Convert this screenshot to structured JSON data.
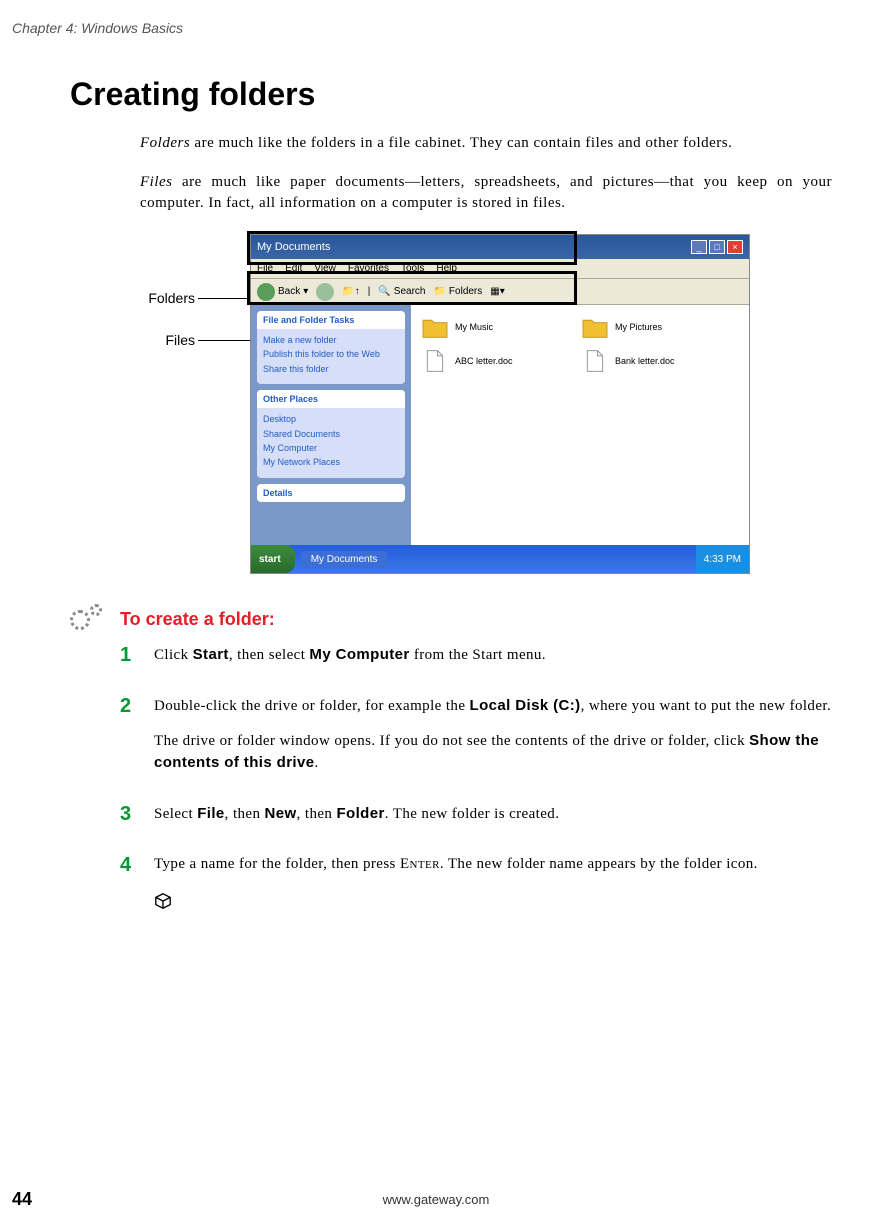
{
  "header": {
    "chapter_label": "Chapter 4: Windows Basics"
  },
  "title": "Creating folders",
  "intro": {
    "p1_emph": "Folders",
    "p1_rest": " are much like the folders in a file cabinet. They can contain files and other folders.",
    "p2_emph": "Files",
    "p2_rest": " are much like paper documents—letters, spreadsheets, and pictures—that you keep on your computer. In fact, all information on a computer is stored in files."
  },
  "callouts": {
    "folders": "Folders",
    "files": "Files"
  },
  "screenshot": {
    "title": "My Documents",
    "menu": [
      "File",
      "Edit",
      "View",
      "Favorites",
      "Tools",
      "Help"
    ],
    "toolbar": {
      "back": "Back",
      "search": "Search",
      "folders": "Folders"
    },
    "sidebar": {
      "panel1_title": "File and Folder Tasks",
      "panel1_items": [
        "Make a new folder",
        "Publish this folder to the Web",
        "Share this folder"
      ],
      "panel2_title": "Other Places",
      "panel2_items": [
        "Desktop",
        "Shared Documents",
        "My Computer",
        "My Network Places"
      ],
      "panel3_title": "Details"
    },
    "items": {
      "folder1": "My Music",
      "folder2": "My Pictures",
      "file1": "ABC letter.doc",
      "file2": "Bank letter.doc"
    },
    "taskbar": {
      "start": "start",
      "item": "My Documents",
      "clock": "4:33 PM"
    }
  },
  "procedure": {
    "title": "To create a folder:",
    "steps": [
      {
        "num": "1",
        "parts": [
          {
            "t": "Click ",
            "cls": ""
          },
          {
            "t": "Start",
            "cls": "bold-sans"
          },
          {
            "t": ", then select ",
            "cls": ""
          },
          {
            "t": "My Computer",
            "cls": "bold-sans"
          },
          {
            "t": " from the Start menu.",
            "cls": ""
          }
        ]
      },
      {
        "num": "2",
        "paragraphs": [
          [
            {
              "t": "Double-click the drive or folder, for example the ",
              "cls": ""
            },
            {
              "t": "Local Disk (C:)",
              "cls": "bold-sans"
            },
            {
              "t": ", where you want to put the new folder.",
              "cls": ""
            }
          ],
          [
            {
              "t": "The drive or folder window opens. If you do not see the contents of the drive or folder, click ",
              "cls": ""
            },
            {
              "t": "Show the contents of this drive",
              "cls": "bold-sans"
            },
            {
              "t": ".",
              "cls": ""
            }
          ]
        ]
      },
      {
        "num": "3",
        "parts": [
          {
            "t": "Select ",
            "cls": ""
          },
          {
            "t": "File",
            "cls": "bold-sans"
          },
          {
            "t": ", then ",
            "cls": ""
          },
          {
            "t": "New",
            "cls": "bold-sans"
          },
          {
            "t": ", then ",
            "cls": ""
          },
          {
            "t": "Folder",
            "cls": "bold-sans"
          },
          {
            "t": ". The new folder is created.",
            "cls": ""
          }
        ]
      },
      {
        "num": "4",
        "parts": [
          {
            "t": "Type a name for the folder, then press ",
            "cls": ""
          },
          {
            "t": "Enter",
            "cls": "smallcaps"
          },
          {
            "t": ". The new folder name appears by the folder icon.",
            "cls": ""
          }
        ]
      }
    ]
  },
  "footer": {
    "page": "44",
    "url": "www.gateway.com"
  }
}
